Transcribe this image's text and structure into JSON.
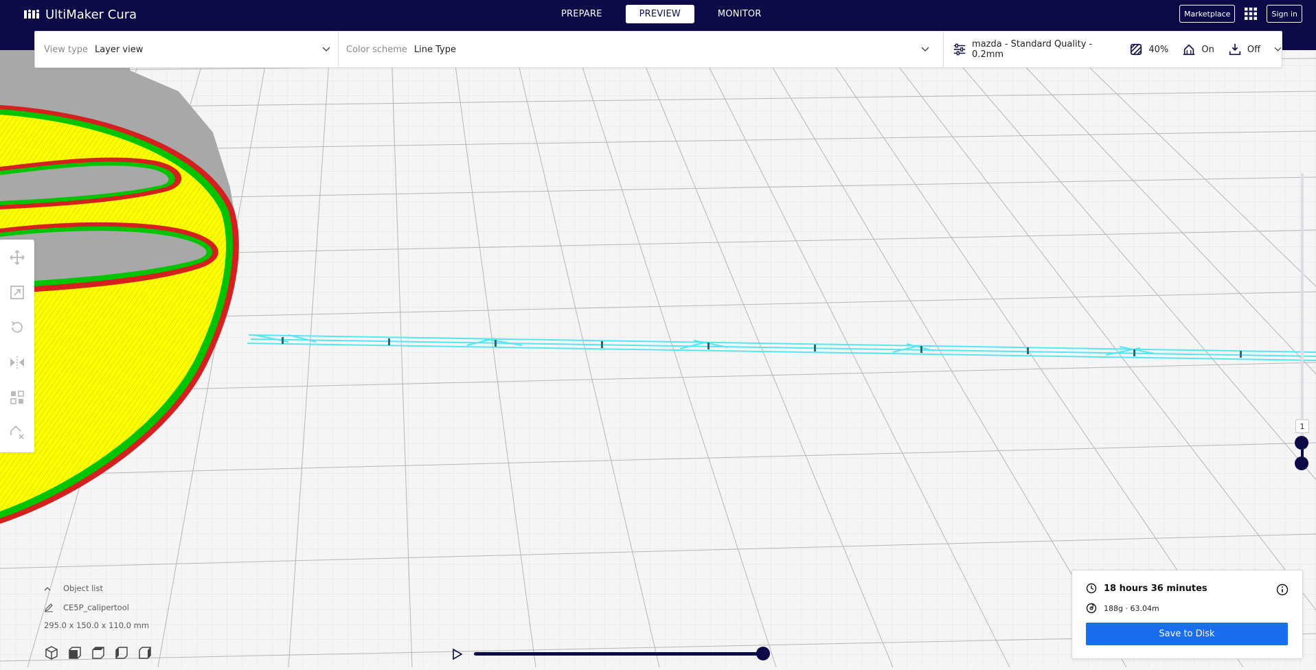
{
  "app": {
    "title": "UltiMaker Cura"
  },
  "stages": [
    {
      "label": "PREPARE",
      "active": false
    },
    {
      "label": "PREVIEW",
      "active": true
    },
    {
      "label": "MONITOR",
      "active": false
    }
  ],
  "topbar": {
    "marketplace_label": "Marketplace",
    "signin_label": "Sign in"
  },
  "header": {
    "view_type_label": "View type",
    "view_type_value": "Layer view",
    "color_scheme_label": "Color scheme",
    "color_scheme_value": "Line Type",
    "profile": "mazda - Standard Quality - 0.2mm",
    "infill": "40%",
    "support": "On",
    "adhesion": "Off"
  },
  "layer_slider": {
    "current_layer": "1"
  },
  "object_list": {
    "header": "Object list",
    "object_name": "CE5P_calipertool",
    "dimensions": "295.0 x 150.0 x 110.0 mm"
  },
  "print_info": {
    "time": "18 hours 36 minutes",
    "material": "188g · 63.04m",
    "save_label": "Save to Disk"
  },
  "colors": {
    "header_bg": "#0c0b47",
    "accent": "#196ef0",
    "infill_yellow": "#ffff00",
    "wall_green": "#00cc00",
    "wall_red": "#d62020",
    "support_cyan": "#55e6f0",
    "model_gray": "#a8a8a8"
  }
}
